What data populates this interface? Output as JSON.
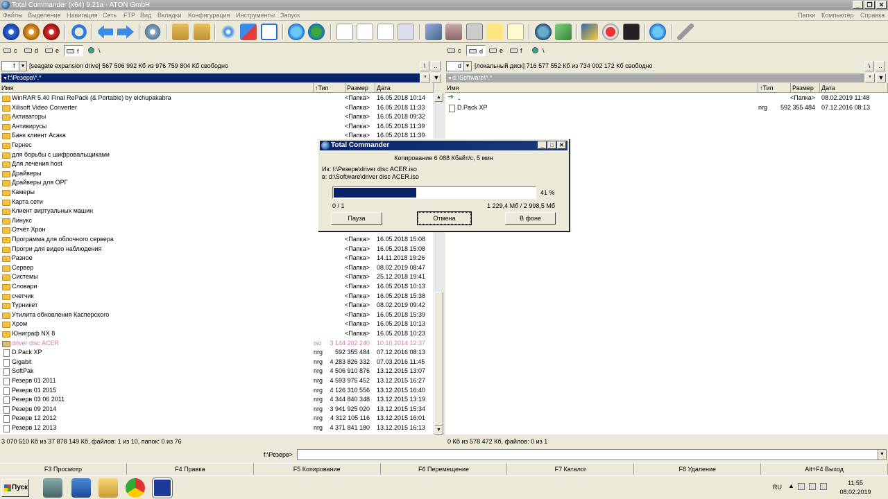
{
  "window": {
    "title": "Total Commander (x64) 9.21a - ATON GmbH",
    "min": "_",
    "restore": "❐",
    "close": "✕"
  },
  "menu": {
    "items": [
      "Файлы",
      "Выделение",
      "Навигация",
      "Сеть",
      "FTP",
      "Вид",
      "Вкладки",
      "Конфигурация",
      "Инструменты",
      "Запуск"
    ],
    "right": [
      "Папки",
      "Компьютер",
      "Справка"
    ]
  },
  "toolbar": {
    "icons": [
      "gear-blue-icon",
      "gear-orange-icon",
      "gear-red-icon",
      "refresh-icon",
      "back-arrow-icon",
      "forward-arrow-icon",
      "settings-icon",
      "pack-icon",
      "unpack-icon",
      "sparkle-icon",
      "sort-az-icon",
      "checklist-icon",
      "browser-icon",
      "globe-icon",
      "note-icon",
      "view-icon",
      "edit-icon",
      "list-icon",
      "eraser-icon",
      "tools-icon",
      "calculator-icon",
      "sticky-icon",
      "notepad-icon",
      "network-icon",
      "drive-icon",
      "media-icon",
      "delete-icon",
      "terminal-icon",
      "globe2-icon",
      "brush-icon"
    ]
  },
  "left": {
    "drives": [
      "c",
      "d",
      "e",
      "f",
      "\\"
    ],
    "drive_combo": "f",
    "volume_info": "[seagate expansion drive]  567 506 992 Кб из 976 759 804 Кб свободно",
    "root_btn": "\\",
    "up_btn": "..",
    "path": "f:\\Резерв\\*.*",
    "path_star": "*",
    "path_arrow": "▼",
    "columns": {
      "name": "Имя",
      "type": "↑Тип",
      "size": "Размер",
      "date": "Дата"
    },
    "rows": [
      {
        "icon": "folder",
        "name": "WinRAR 5.40 Final RePack (& Portable) by elchupakabra",
        "ext": "",
        "size": "<Папка>",
        "date": "16.05.2018 10:14"
      },
      {
        "icon": "folder",
        "name": "Xilisoft Video Converter",
        "ext": "",
        "size": "<Папка>",
        "date": "16.05.2018 11:33"
      },
      {
        "icon": "folder",
        "name": "Активаторы",
        "ext": "",
        "size": "<Папка>",
        "date": "16.05.2018 09:32"
      },
      {
        "icon": "folder",
        "name": "Антивирусы",
        "ext": "",
        "size": "<Папка>",
        "date": "16.05.2018 11:39"
      },
      {
        "icon": "folder",
        "name": "Банк клиент Асака",
        "ext": "",
        "size": "<Папка>",
        "date": "16.05.2018 11:39"
      },
      {
        "icon": "folder",
        "name": "Гернес",
        "ext": "",
        "size": "",
        "date": ""
      },
      {
        "icon": "folder",
        "name": "для борьбы с шифровальщиками",
        "ext": "",
        "size": "",
        "date": ""
      },
      {
        "icon": "folder",
        "name": "Для лечения host",
        "ext": "",
        "size": "",
        "date": ""
      },
      {
        "icon": "folder",
        "name": "Драйверы",
        "ext": "",
        "size": "",
        "date": ""
      },
      {
        "icon": "folder",
        "name": "Драйверы для ОРГ",
        "ext": "",
        "size": "",
        "date": ""
      },
      {
        "icon": "folder",
        "name": "Камеры",
        "ext": "",
        "size": "",
        "date": ""
      },
      {
        "icon": "folder",
        "name": "Карта сети",
        "ext": "",
        "size": "",
        "date": ""
      },
      {
        "icon": "folder",
        "name": "Клиент виртуальных машин",
        "ext": "",
        "size": "",
        "date": ""
      },
      {
        "icon": "folder",
        "name": "Линукс",
        "ext": "",
        "size": "",
        "date": ""
      },
      {
        "icon": "folder",
        "name": "Отчёт Хрон",
        "ext": "",
        "size": "",
        "date": ""
      },
      {
        "icon": "folder",
        "name": "Программа для облочного сервера",
        "ext": "",
        "size": "<Папка>",
        "date": "16.05.2018 15:08"
      },
      {
        "icon": "folder",
        "name": "Прогри для видео наблюдения",
        "ext": "",
        "size": "<Папка>",
        "date": "16.05.2018 15:08"
      },
      {
        "icon": "folder",
        "name": "Разное",
        "ext": "",
        "size": "<Папка>",
        "date": "14.11.2018 19:26"
      },
      {
        "icon": "folder",
        "name": "Сервер",
        "ext": "",
        "size": "<Папка>",
        "date": "08.02.2019 08:47"
      },
      {
        "icon": "folder",
        "name": "Системы",
        "ext": "",
        "size": "<Папка>",
        "date": "25.12.2018 19:41"
      },
      {
        "icon": "folder",
        "name": "Словари",
        "ext": "",
        "size": "<Папка>",
        "date": "16.05.2018 10:13"
      },
      {
        "icon": "folder",
        "name": "счетчик",
        "ext": "",
        "size": "<Папка>",
        "date": "16.05.2018 15:38"
      },
      {
        "icon": "folder",
        "name": "Турникет",
        "ext": "",
        "size": "<Папка>",
        "date": "08.02.2019 09:42"
      },
      {
        "icon": "folder",
        "name": "Утилита обновления Касперского",
        "ext": "",
        "size": "<Папка>",
        "date": "16.05.2018 15:39"
      },
      {
        "icon": "folder",
        "name": "Хром",
        "ext": "",
        "size": "<Папка>",
        "date": "16.05.2018 10:13"
      },
      {
        "icon": "folder",
        "name": "Юниграф NX 8",
        "ext": "",
        "size": "<Папка>",
        "date": "16.05.2018 10:23"
      },
      {
        "icon": "iso",
        "name": "driver disc ACER",
        "ext": "iso",
        "size": "3 144 202 240",
        "date": "10.10.2014 12:37",
        "pink": true
      },
      {
        "icon": "file",
        "name": "D.Pack XP",
        "ext": "nrg",
        "size": "592 355 484",
        "date": "07.12.2016 08:13"
      },
      {
        "icon": "file",
        "name": "Gigabit",
        "ext": "nrg",
        "size": "4 283 826 332",
        "date": "07.03.2016 11:45"
      },
      {
        "icon": "file",
        "name": "SoftPak",
        "ext": "nrg",
        "size": "4 506 910 876",
        "date": "13.12.2015 13:07"
      },
      {
        "icon": "file",
        "name": "Резерв 01 2011",
        "ext": "nrg",
        "size": "4 593 975 452",
        "date": "13.12.2015 16:27"
      },
      {
        "icon": "file",
        "name": "Резерв 01 2015",
        "ext": "nrg",
        "size": "4 126 310 556",
        "date": "13.12.2015 16:40"
      },
      {
        "icon": "file",
        "name": "Резерв 03 06 2011",
        "ext": "nrg",
        "size": "4 344 840 348",
        "date": "13.12.2015 13:19"
      },
      {
        "icon": "file",
        "name": "Резерв 09 2014",
        "ext": "nrg",
        "size": "3 941 925 020",
        "date": "13.12.2015 15:34"
      },
      {
        "icon": "file",
        "name": "Резерв 12 2012",
        "ext": "nrg",
        "size": "4 312 105 116",
        "date": "13.12.2015 16:01"
      },
      {
        "icon": "file",
        "name": "Резерв 12 2013",
        "ext": "nrg",
        "size": "4 371 841 180",
        "date": "13.12.2015 16:13"
      }
    ],
    "status": "3 070 510 Кб из 37 878 149 Кб, файлов: 1 из 10, папок: 0 из 76"
  },
  "right": {
    "drives": [
      "c",
      "d",
      "e",
      "f",
      "\\"
    ],
    "drive_combo": "d",
    "volume_info": "[локальный диск]  716 577 552 Кб из 734 002 172 Кб свободно",
    "root_btn": "\\",
    "up_btn": "..",
    "path": "d:\\Software\\*.*",
    "path_star": "*",
    "path_arrow": "▼",
    "columns": {
      "name": "Имя",
      "type": "↑Тип",
      "size": "Размер",
      "date": "Дата"
    },
    "rows": [
      {
        "icon": "up",
        "name": "..",
        "ext": "",
        "size": "<Папка>",
        "date": "08.02.2019 11:48"
      },
      {
        "icon": "file",
        "name": "D.Pack XP",
        "ext": "nrg",
        "size": "592 355 484",
        "date": "07.12.2016 08:13"
      }
    ],
    "status": "0 Кб из 578 472 Кб, файлов: 0 из 1"
  },
  "cmdline": {
    "prompt": "f:\\Резерв>",
    "value": ""
  },
  "fkeys": [
    "F3 Просмотр",
    "F4 Правка",
    "F5 Копирование",
    "F6 Перемещение",
    "F7 Каталог",
    "F8 Удаление",
    "Alt+F4 Выход"
  ],
  "dialog": {
    "title": "Total Commander",
    "status_line": "Копирование 6 088 Кбайт/с, 5 мин",
    "from": "Из:  f:\\Резерв\\driver disc ACER.iso",
    "to": "в:  d:\\Software\\driver disc ACER.iso",
    "progress_percent": 41,
    "progress_label": "41 %",
    "files_count": "0 / 1",
    "size_progress": "1 229,4 Мб / 2 998,5 Мб",
    "buttons": {
      "pause": "Пауза",
      "cancel": "Отмена",
      "background": "В фоне"
    }
  },
  "taskbar": {
    "start": "Пуск",
    "apps": [
      "network-app-icon",
      "powershell-icon",
      "explorer-icon",
      "chrome-icon",
      "total-commander-icon"
    ],
    "lang": "RU",
    "time": "11:55",
    "date": "08.02.2019"
  }
}
